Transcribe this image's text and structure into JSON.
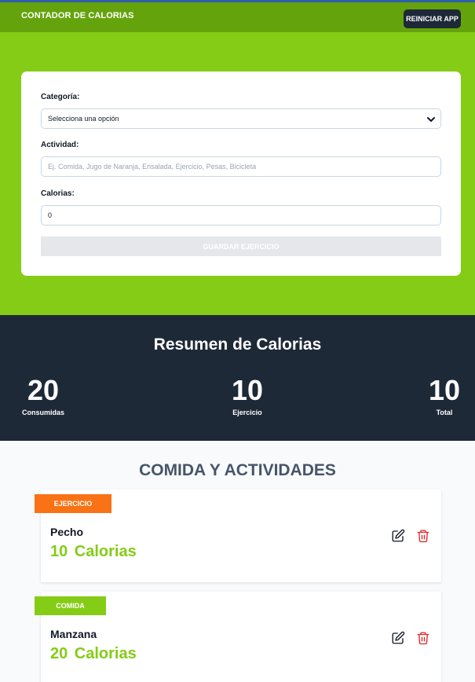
{
  "header": {
    "title": "CONTADOR DE CALORIAS",
    "reset_label": "REINICIAR APP"
  },
  "colors": {
    "header": "#65a30d",
    "form_band": "#84cc16",
    "summary_bg": "#1e2937",
    "exercise_badge": "#f97316",
    "food_badge": "#84cc16",
    "delete_icon": "#dc2626"
  },
  "form": {
    "category_label": "Categoría:",
    "category_value": "Selecciona una opción",
    "activity_label": "Actividad:",
    "activity_placeholder": "Ej. Comida, Jugo de Naranja, Ensalada, Ejercicio, Pesas, Bicicleta",
    "calories_label": "Calorias:",
    "calories_value": "0",
    "save_label": "GUARDAR EJERCICIO"
  },
  "summary": {
    "title": "Resumen de Calorias",
    "consumed": {
      "value": "20",
      "label": "Consumidas"
    },
    "exercise": {
      "value": "10",
      "label": "Ejercicio"
    },
    "total": {
      "value": "10",
      "label": "Total"
    }
  },
  "activities": {
    "title": "COMIDA Y ACTIVIDADES",
    "items": [
      {
        "category": "EJERCICIO",
        "name": "Pecho",
        "calories": "10 Calorias",
        "edit_icon": "pencil-square-icon",
        "delete_icon": "trash-icon"
      },
      {
        "category": "COMIDA",
        "name": "Manzana",
        "calories": "20 Calorias",
        "edit_icon": "pencil-square-icon",
        "delete_icon": "trash-icon"
      }
    ]
  }
}
